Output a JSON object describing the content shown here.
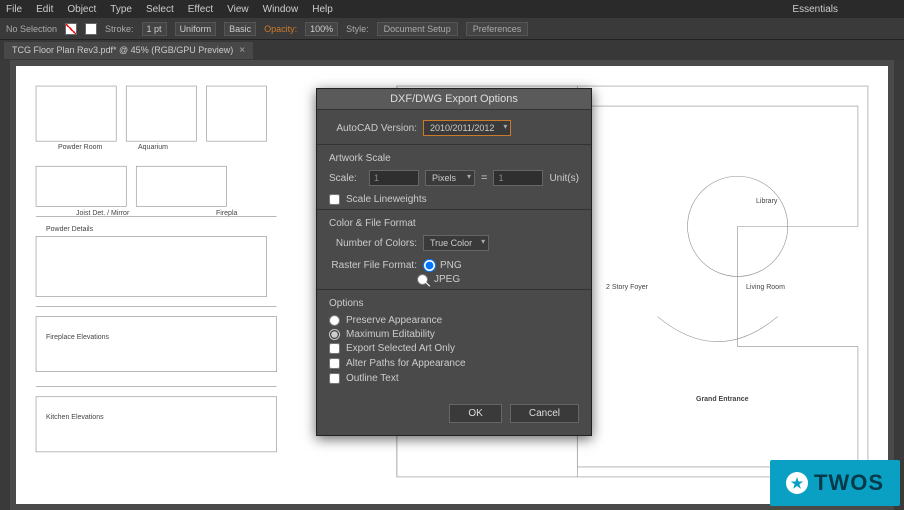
{
  "menubar": {
    "items": [
      "File",
      "Edit",
      "Object",
      "Type",
      "Select",
      "Effect",
      "View",
      "Window",
      "Help"
    ],
    "workspace": "Essentials"
  },
  "controlbar": {
    "selection": "No Selection",
    "stroke_label": "Stroke:",
    "stroke_value": "1 pt",
    "stroke_style": "Uniform",
    "stroke_profile": "Basic",
    "opacity_label": "Opacity:",
    "opacity_value": "100%",
    "style_label": "Style:",
    "doc_setup": "Document Setup",
    "preferences": "Preferences"
  },
  "tab": {
    "title": "TCG Floor Plan Rev3.pdf* @ 45% (RGB/GPU Preview)"
  },
  "canvas_labels": {
    "powder_room": "Powder Room",
    "aquarium": "Aquarium",
    "joist": "Joist Det. / Mirror",
    "firepl": "Firepla",
    "powder_details": "Powder Details",
    "fireplace_elev": "Fireplace Elevations",
    "kitchen_elev": "Kitchen Elevations",
    "library": "Library",
    "story_foyer": "2 Story Foyer",
    "living_room": "Living Room",
    "grand_entrance": "Grand Entrance"
  },
  "dialog": {
    "title": "DXF/DWG Export Options",
    "autocad_label": "AutoCAD Version:",
    "autocad_value": "2010/2011/2012",
    "artwork_scale_head": "Artwork Scale",
    "scale_label": "Scale:",
    "scale_from": "1",
    "scale_from_units": "Pixels",
    "scale_to": "1",
    "scale_to_units": "Unit(s)",
    "scale_lineweights": "Scale Lineweights",
    "color_head": "Color & File Format",
    "num_colors_label": "Number of Colors:",
    "num_colors_value": "True Color",
    "raster_format_label": "Raster File Format:",
    "raster_png": "PNG",
    "raster_jpeg": "JPEG",
    "options_head": "Options",
    "opt_preserve": "Preserve Appearance",
    "opt_max_edit": "Maximum Editability",
    "opt_export_sel": "Export Selected Art Only",
    "opt_alter_paths": "Alter Paths for Appearance",
    "opt_outline_text": "Outline Text",
    "ok": "OK",
    "cancel": "Cancel"
  },
  "watermark": {
    "text": "TWOS"
  }
}
